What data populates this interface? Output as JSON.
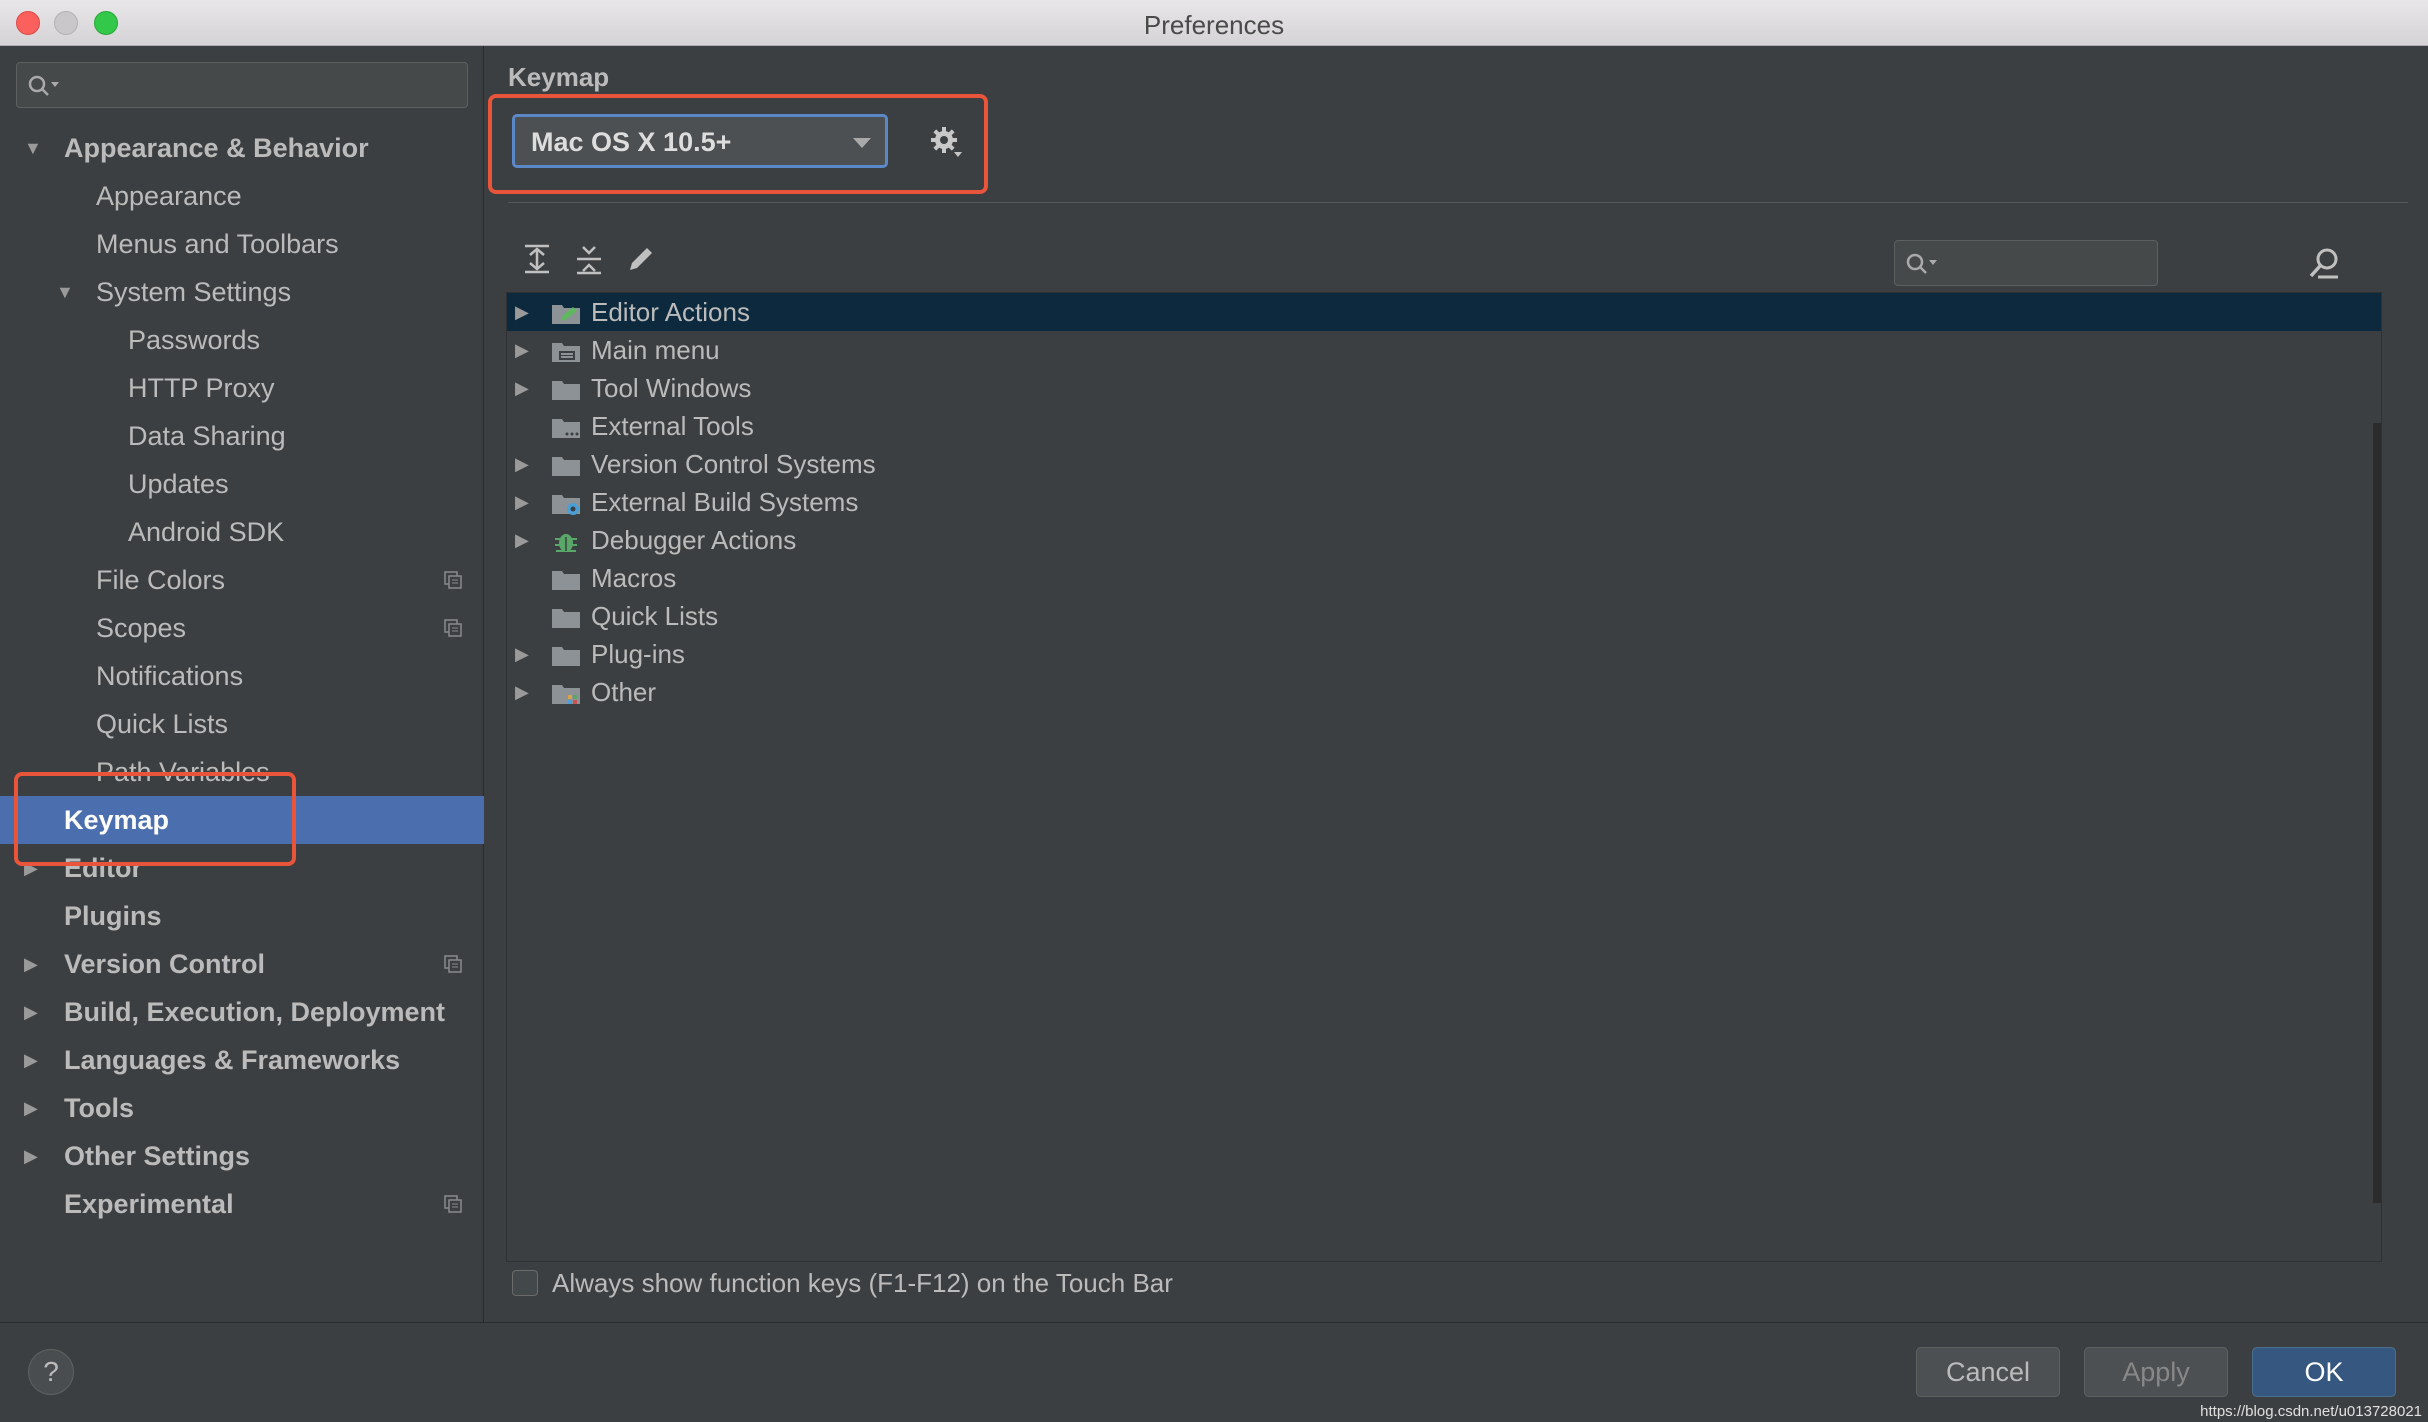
{
  "window": {
    "title": "Preferences"
  },
  "sidebar": {
    "search": {
      "value": "",
      "placeholder": ""
    },
    "items": [
      {
        "label": "Appearance & Behavior",
        "level": 0,
        "bold": true,
        "expander": "expanded"
      },
      {
        "label": "Appearance",
        "level": 1
      },
      {
        "label": "Menus and Toolbars",
        "level": 1
      },
      {
        "label": "System Settings",
        "level": 1,
        "expander": "expanded"
      },
      {
        "label": "Passwords",
        "level": 2
      },
      {
        "label": "HTTP Proxy",
        "level": 2
      },
      {
        "label": "Data Sharing",
        "level": 2
      },
      {
        "label": "Updates",
        "level": 2
      },
      {
        "label": "Android SDK",
        "level": 2
      },
      {
        "label": "File Colors",
        "level": 1,
        "project_icon": true
      },
      {
        "label": "Scopes",
        "level": 1,
        "project_icon": true
      },
      {
        "label": "Notifications",
        "level": 1
      },
      {
        "label": "Quick Lists",
        "level": 1
      },
      {
        "label": "Path Variables",
        "level": 1
      },
      {
        "label": "Keymap",
        "level": 0,
        "bold": true,
        "selected": true
      },
      {
        "label": "Editor",
        "level": 0,
        "bold": true,
        "expander": "collapsed"
      },
      {
        "label": "Plugins",
        "level": 0,
        "bold": true
      },
      {
        "label": "Version Control",
        "level": 0,
        "bold": true,
        "expander": "collapsed",
        "project_icon": true
      },
      {
        "label": "Build, Execution, Deployment",
        "level": 0,
        "bold": true,
        "expander": "collapsed"
      },
      {
        "label": "Languages & Frameworks",
        "level": 0,
        "bold": true,
        "expander": "collapsed"
      },
      {
        "label": "Tools",
        "level": 0,
        "bold": true,
        "expander": "collapsed"
      },
      {
        "label": "Other Settings",
        "level": 0,
        "bold": true,
        "expander": "collapsed"
      },
      {
        "label": "Experimental",
        "level": 0,
        "bold": true,
        "project_icon": true
      }
    ]
  },
  "main": {
    "title": "Keymap",
    "keymap_select": {
      "value": "Mac OS X 10.5+"
    },
    "toolbar": {
      "expand_all": "expand-all-icon",
      "collapse_all": "collapse-all-icon",
      "edit": "edit-pencil-icon",
      "search": {
        "value": "",
        "placeholder": ""
      },
      "find_by_shortcut": "find-shortcut-icon"
    },
    "actions": [
      {
        "label": "Editor Actions",
        "expandable": true,
        "selected": true,
        "icon": "editor-actions-icon"
      },
      {
        "label": "Main menu",
        "expandable": true,
        "icon": "main-menu-icon"
      },
      {
        "label": "Tool Windows",
        "expandable": true,
        "icon": "folder-icon"
      },
      {
        "label": "External Tools",
        "expandable": false,
        "icon": "external-tools-icon"
      },
      {
        "label": "Version Control Systems",
        "expandable": true,
        "icon": "folder-icon"
      },
      {
        "label": "External Build Systems",
        "expandable": true,
        "icon": "external-build-icon"
      },
      {
        "label": "Debugger Actions",
        "expandable": true,
        "icon": "debugger-bug-icon"
      },
      {
        "label": "Macros",
        "expandable": false,
        "icon": "folder-icon"
      },
      {
        "label": "Quick Lists",
        "expandable": false,
        "icon": "folder-icon"
      },
      {
        "label": "Plug-ins",
        "expandable": true,
        "icon": "folder-icon"
      },
      {
        "label": "Other",
        "expandable": true,
        "icon": "other-icon"
      }
    ],
    "touch_bar": {
      "label": "Always show function keys (F1-F12) on the Touch Bar",
      "checked": false
    }
  },
  "footer": {
    "help": "?",
    "cancel": "Cancel",
    "apply": "Apply",
    "ok": "OK",
    "watermark": "https://blog.csdn.net/u013728021"
  },
  "colors": {
    "accent_selected": "#4b6eaf",
    "list_selected": "#0d293e",
    "highlight_box": "#e8553a",
    "ok_button": "#365880"
  }
}
